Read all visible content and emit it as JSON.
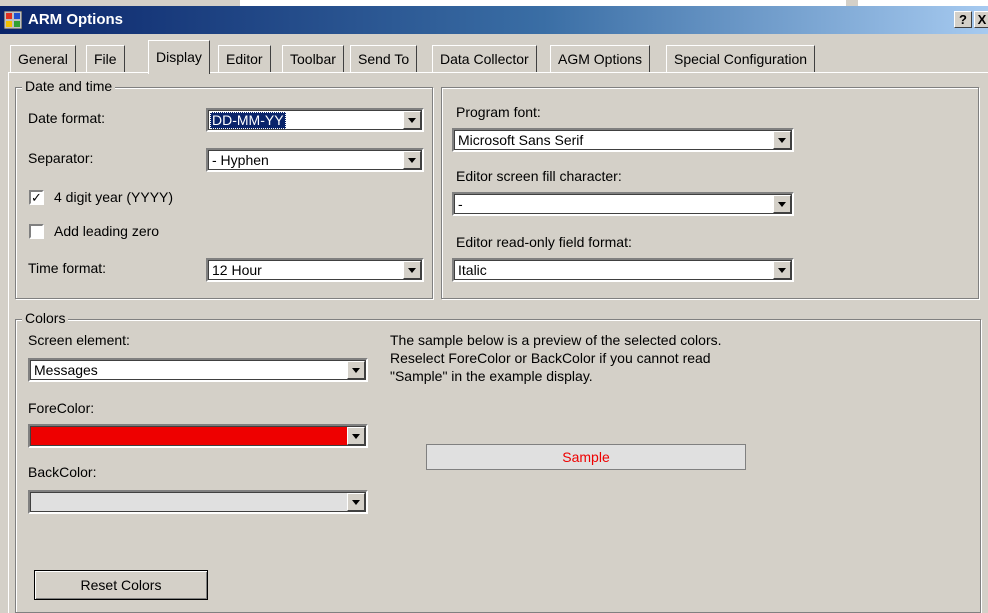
{
  "window": {
    "title": "ARM Options",
    "help_glyph": "?",
    "close_glyph": "X"
  },
  "tabs": [
    {
      "label": "General"
    },
    {
      "label": "File"
    },
    {
      "label": "Display"
    },
    {
      "label": "Editor"
    },
    {
      "label": "Toolbar"
    },
    {
      "label": "Send To"
    },
    {
      "label": "Data Collector"
    },
    {
      "label": "AGM Options"
    },
    {
      "label": "Special Configuration"
    }
  ],
  "active_tab": "Display",
  "date_time": {
    "legend": "Date and time",
    "date_format_label": "Date format:",
    "date_format_value": "DD-MM-YY",
    "separator_label": "Separator:",
    "separator_value": "- Hyphen",
    "four_digit_year_label": "4 digit year (YYYY)",
    "four_digit_year_checked": true,
    "check_glyph": "✓",
    "leading_zero_label": "Add leading zero",
    "leading_zero_checked": false,
    "time_format_label": "Time format:",
    "time_format_value": "12 Hour"
  },
  "fonts": {
    "program_font_label": "Program font:",
    "program_font_value": "Microsoft Sans Serif",
    "fill_char_label": "Editor screen fill character:",
    "fill_char_value": "-",
    "readonly_format_label": "Editor read-only field format:",
    "readonly_format_value": "Italic"
  },
  "colors": {
    "legend": "Colors",
    "screen_element_label": "Screen element:",
    "screen_element_value": "Messages",
    "forecolor_label": "ForeColor:",
    "forecolor_hex": "#ee0000",
    "backcolor_label": "BackColor:",
    "backcolor_hex": "#e0e0e0",
    "info_line1": "The sample below is a preview of the selected colors.",
    "info_line2": "Reselect ForeColor or BackColor if you cannot read",
    "info_line3": "\"Sample\"  in the example display.",
    "sample_text": "Sample",
    "reset_button": "Reset Colors"
  }
}
